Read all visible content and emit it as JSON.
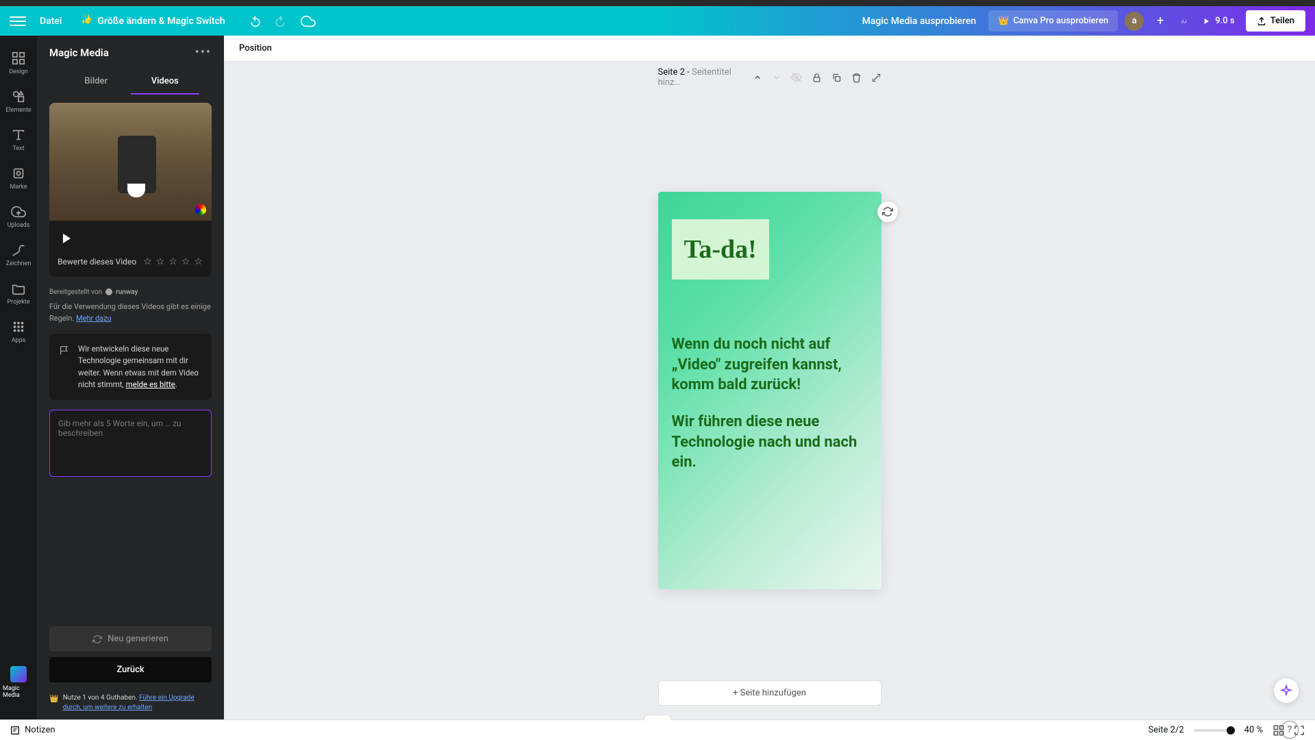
{
  "topbar": {
    "file": "Datei",
    "magic_switch": "Größe ändern & Magic Switch",
    "doc_title": "Magic Media ausprobieren",
    "pro_btn": "Canva Pro ausprobieren",
    "avatar": "a",
    "duration": "9.0 s",
    "share": "Teilen"
  },
  "rail": {
    "design": "Design",
    "elements": "Elemente",
    "text": "Text",
    "brand": "Marke",
    "uploads": "Uploads",
    "draw": "Zeichnen",
    "projects": "Projekte",
    "apps": "Apps",
    "magic_media": "Magic Media"
  },
  "panel": {
    "title": "Magic Media",
    "tab_images": "Bilder",
    "tab_videos": "Videos",
    "rating_label": "Bewerte dieses Video",
    "provider_prefix": "Bereitgestellt von",
    "provider": "runway",
    "rules_text": "Für die Verwendung dieses Videos gibt es einige Regeln.",
    "rules_link": "Mehr dazu",
    "info_text": "Wir entwickeln diese neue Technologie gemeinsam mit dir weiter. Wenn etwas mit dem Video nicht stimmt,",
    "report_link": "melde es bitte",
    "prompt_placeholder": "Gib mehr als 5 Worte ein, um … zu beschreiben",
    "regenerate": "Neu generieren",
    "back": "Zurück",
    "credits_text": "Nutze 1 von 4 Guthaben.",
    "upgrade_link": "Führe ein Upgrade durch, um weitere zu erhalten"
  },
  "canvas": {
    "position": "Position",
    "page_label": "Seite 2",
    "page_title_hint": "Seitentitel hinz…",
    "tada": "Ta-da!",
    "body_line1": "Wenn du noch nicht auf „Video\" zugreifen kannst, komm bald zurück!",
    "body_line2": "Wir führen diese neue Technologie nach und nach ein.",
    "add_page": "+ Seite hinzufügen"
  },
  "bottom": {
    "notes": "Notizen",
    "page_indicator": "Seite 2/2",
    "zoom": "40 %"
  }
}
